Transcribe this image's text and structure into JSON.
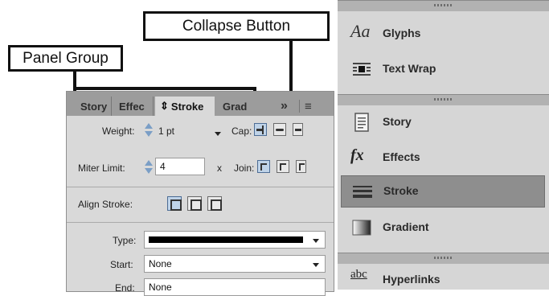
{
  "callouts": {
    "collapse": "Collapse Button",
    "panel_group": "Panel Group"
  },
  "panel": {
    "tabs": [
      "Story",
      "Effec",
      "Stroke",
      "Grad"
    ],
    "active_tab_glyph": "⇕",
    "collapse_glyph": "»",
    "menu_glyph": "≡",
    "weight": {
      "label": "Weight:",
      "value": "1 pt"
    },
    "cap": {
      "label": "Cap:"
    },
    "miter": {
      "label": "Miter Limit:",
      "value": "4",
      "suffix": "x"
    },
    "join": {
      "label": "Join:"
    },
    "align_stroke": {
      "label": "Align Stroke:"
    },
    "type": {
      "label": "Type:"
    },
    "start": {
      "label": "Start:",
      "value": "None"
    },
    "end": {
      "label": "End:",
      "value": "None"
    }
  },
  "right_panel": {
    "items": [
      {
        "label": "Glyphs",
        "icon": "glyphs-icon",
        "glyph": "Aa"
      },
      {
        "label": "Text Wrap",
        "icon": "text-wrap-icon"
      },
      {
        "label": "Story",
        "icon": "story-icon"
      },
      {
        "label": "Effects",
        "icon": "effects-icon",
        "glyph": "fx"
      },
      {
        "label": "Stroke",
        "icon": "stroke-icon"
      },
      {
        "label": "Gradient",
        "icon": "gradient-icon"
      },
      {
        "label": "Hyperlinks",
        "icon": "hyperlinks-icon",
        "glyph": "abc"
      }
    ]
  },
  "colors": {
    "panel_bg": "#d9d9d9",
    "tabbar": "#9c9c9c",
    "selected_row": "#8e8e8e",
    "accent_blue": "#7a9ec6"
  }
}
